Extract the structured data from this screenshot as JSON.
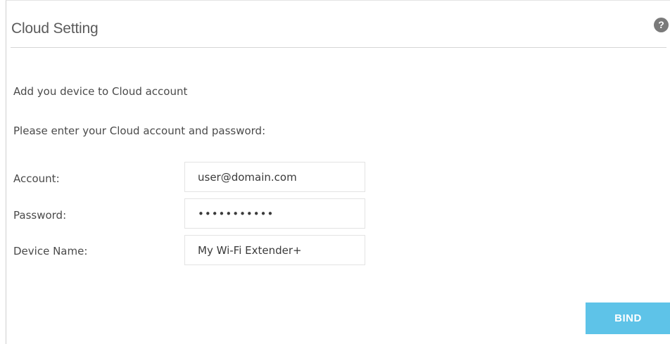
{
  "panel": {
    "title": "Cloud Setting",
    "help_glyph": "?"
  },
  "content": {
    "intro": "Add you device to Cloud account",
    "prompt": "Please enter your Cloud account and password:"
  },
  "form": {
    "account": {
      "label": "Account:",
      "value": "user@domain.com"
    },
    "password": {
      "label": "Password:",
      "value": "•••••••••••"
    },
    "device_name": {
      "label": "Device Name:",
      "value": "My Wi-Fi Extender+"
    }
  },
  "actions": {
    "bind_label": "BIND"
  },
  "colors": {
    "accent": "#5ec3e8",
    "help_icon": "#7a7a7a",
    "text": "#4a4a4a"
  },
  "icons": {
    "help": "help-icon"
  }
}
